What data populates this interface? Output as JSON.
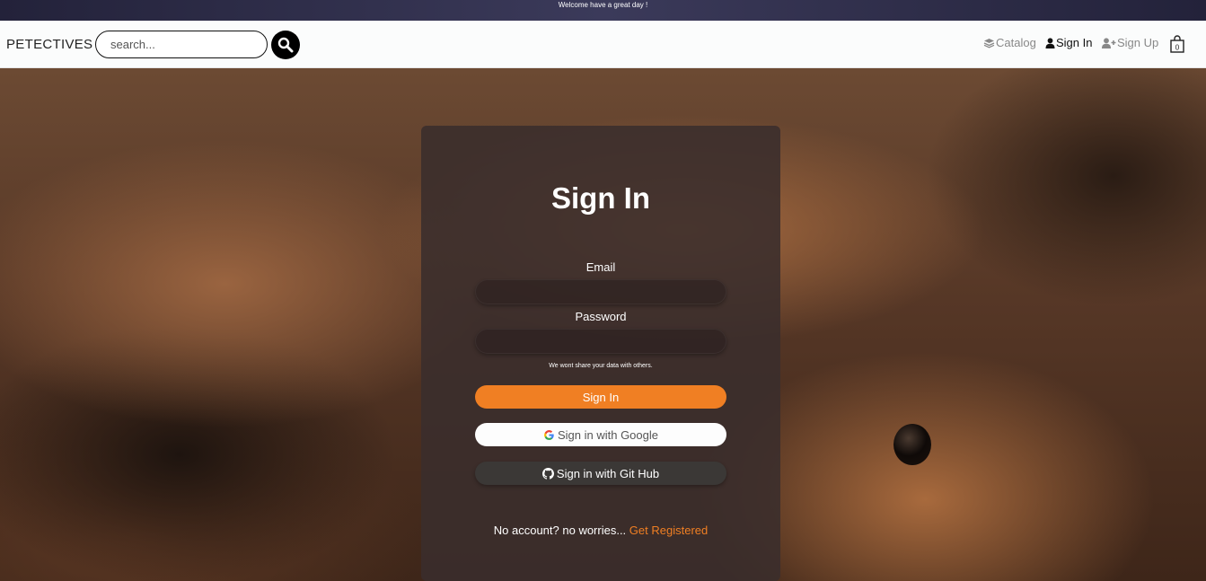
{
  "announcement": "Welcome have a great day !",
  "header": {
    "brand": "PETECTIVES",
    "search_placeholder": "search...",
    "nav": {
      "catalog": "Catalog",
      "sign_in": "Sign In",
      "sign_up": "Sign Up",
      "cart_count": "0"
    }
  },
  "signin_card": {
    "title": "Sign In",
    "email_label": "Email",
    "email_value": "",
    "password_label": "Password",
    "password_value": "",
    "privacy_note": "We wont share your data with others.",
    "submit_label": "Sign In",
    "google_label": "Sign in with Google",
    "github_label": "Sign in with Git Hub",
    "register_prompt": "No account? no worries...",
    "register_link": "Get Registered"
  },
  "colors": {
    "accent": "#f07f23",
    "announce_bar": "#2c2b45",
    "card_bg": "#3a2e2c"
  },
  "icons": {
    "search": "magnifier-icon",
    "catalog": "layers-icon",
    "sign_in": "user-icon",
    "sign_up": "user-plus-icon",
    "cart": "shopping-bag-icon",
    "google": "google-g-icon",
    "github": "github-icon"
  }
}
